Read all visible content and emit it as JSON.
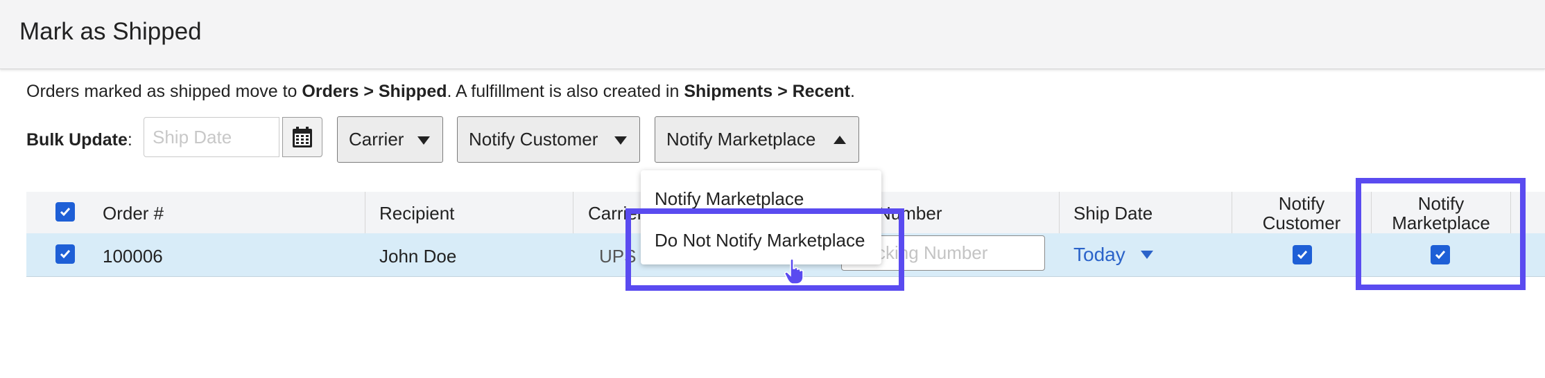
{
  "header": {
    "title": "Mark as Shipped"
  },
  "info": {
    "prefix": "Orders marked as shipped move to ",
    "bold1": "Orders > Shipped",
    "middle": ". A fulfillment is also created in ",
    "bold2": "Shipments > Recent",
    "suffix": "."
  },
  "bulk": {
    "label": "Bulk Update",
    "colon": ":",
    "ship_date_placeholder": "Ship Date",
    "carrier": "Carrier",
    "notify_customer": "Notify Customer",
    "notify_marketplace": "Notify Marketplace"
  },
  "dropdown": {
    "options": [
      "Notify Marketplace",
      "Do Not Notify Marketplace"
    ]
  },
  "table": {
    "columns": {
      "order": "Order #",
      "recipient": "Recipient",
      "carrier": "Carrier",
      "tracking": "Tracking Number",
      "tracking_visible": "Number",
      "ship_date": "Ship Date",
      "notify_customer_l1": "Notify",
      "notify_customer_l2": "Customer",
      "notify_marketplace_l1": "Notify",
      "notify_marketplace_l2": "Marketplace"
    },
    "rows": [
      {
        "order": "100006",
        "recipient": "John Doe",
        "carrier": "UPS",
        "tracking_placeholder": "Tracking Number",
        "ship_date": "Today",
        "notify_customer": true,
        "notify_marketplace": true
      }
    ]
  },
  "colors": {
    "accent": "#1e5fd6",
    "highlight": "#5a4bf0",
    "row_selected": "#d8ecf8",
    "link": "#2b63c9"
  }
}
